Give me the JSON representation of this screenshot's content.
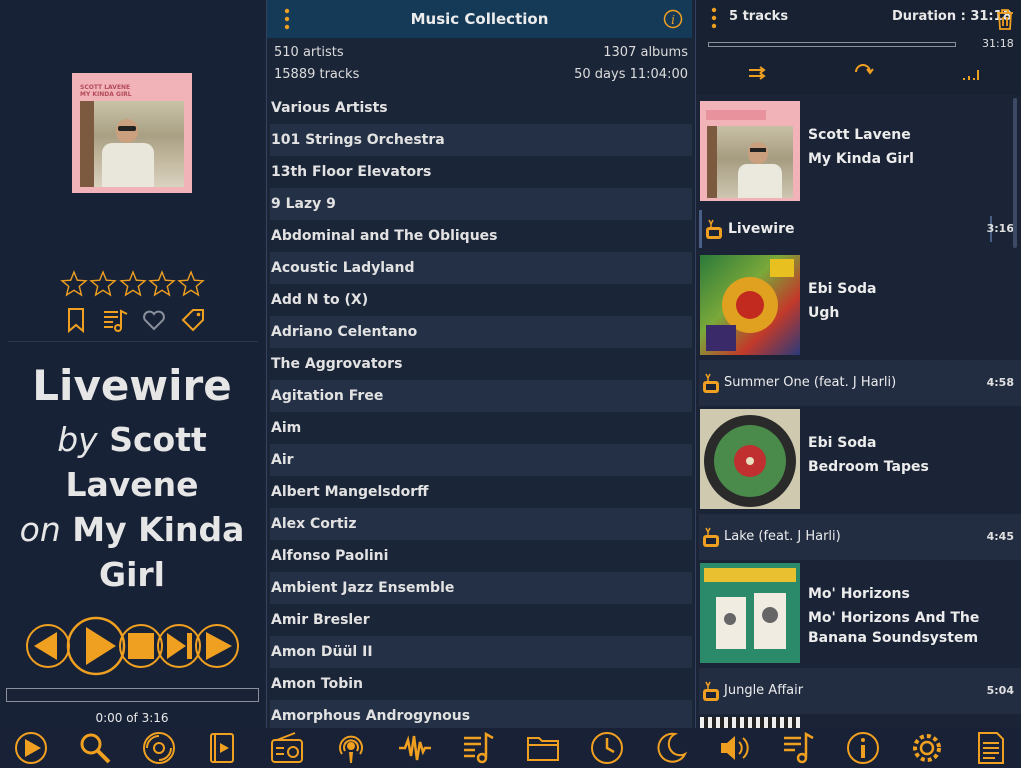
{
  "colors": {
    "accent": "#f0a020",
    "background": "#1a2336",
    "header": "#153a58",
    "row_alt": "#233045",
    "text": "#e8e8e8"
  },
  "left_panel": {
    "cover_text": [
      "SCOTT LAVENE",
      "MY KINDA GIRL"
    ],
    "rating_stars": 0,
    "rating_max": 5,
    "action_icons": [
      "bookmark-icon",
      "playlist-add-icon",
      "heart-icon",
      "tag-icon"
    ],
    "now_playing": {
      "title": "Livewire",
      "by_word": "by",
      "artist": "Scott Lavene",
      "on_word": "on",
      "album": "My Kinda Girl"
    },
    "transport_icons": [
      "previous-icon",
      "play-icon",
      "stop-icon",
      "next-track-icon",
      "next-icon"
    ],
    "progress_fraction": 0,
    "time_text": "0:00 of 3:16"
  },
  "middle_panel": {
    "title": "Music Collection",
    "stats": {
      "artists": "510 artists",
      "albums": "1307 albums",
      "tracks": "15889 tracks",
      "duration": "50 days 11:04:00"
    },
    "artists": [
      "Various Artists",
      "101 Strings Orchestra",
      "13th Floor Elevators",
      "9 Lazy 9",
      "Abdominal and The Obliques",
      "Acoustic Ladyland",
      "Add N to (X)",
      "Adriano Celentano",
      "The Aggrovators",
      "Agitation Free",
      "Aim",
      "Air",
      "Albert Mangelsdorff",
      "Alex Cortiz",
      "Alfonso Paolini",
      "Ambient Jazz Ensemble",
      "Amir Bresler",
      "Amon Düül II",
      "Amon Tobin",
      "Amorphous Androgynous"
    ]
  },
  "right_panel": {
    "track_count": "5 tracks",
    "duration": "Duration : 31:18",
    "bar_time": "31:18",
    "queue": [
      {
        "artist": "Scott Lavene",
        "album": "My Kinda Girl",
        "track": {
          "title": "Livewire",
          "duration": "3:16",
          "current": true
        }
      },
      {
        "artist": "Ebi Soda",
        "album": "Ugh",
        "track": {
          "title": "Summer One (feat. J Harli)",
          "duration": "4:58",
          "current": false
        }
      },
      {
        "artist": "Ebi Soda",
        "album": "Bedroom Tapes",
        "track": {
          "title": "Lake (feat. J Harli)",
          "duration": "4:45",
          "current": false
        }
      },
      {
        "artist": "Mo' Horizons",
        "album": "Mo' Horizons And The Banana Soundsystem",
        "track": {
          "title": "Jungle Affair",
          "duration": "5:04",
          "current": false
        }
      }
    ]
  },
  "bottom_nav": [
    "play-nav-icon",
    "search-icon",
    "disc-icon",
    "video-icon",
    "radio-icon",
    "podcast-icon",
    "waveform-icon",
    "playlist-icon",
    "folder-icon",
    "clock-icon",
    "moon-icon",
    "volume-icon",
    "playlist-alt-icon",
    "info-icon",
    "settings-icon",
    "document-icon"
  ]
}
